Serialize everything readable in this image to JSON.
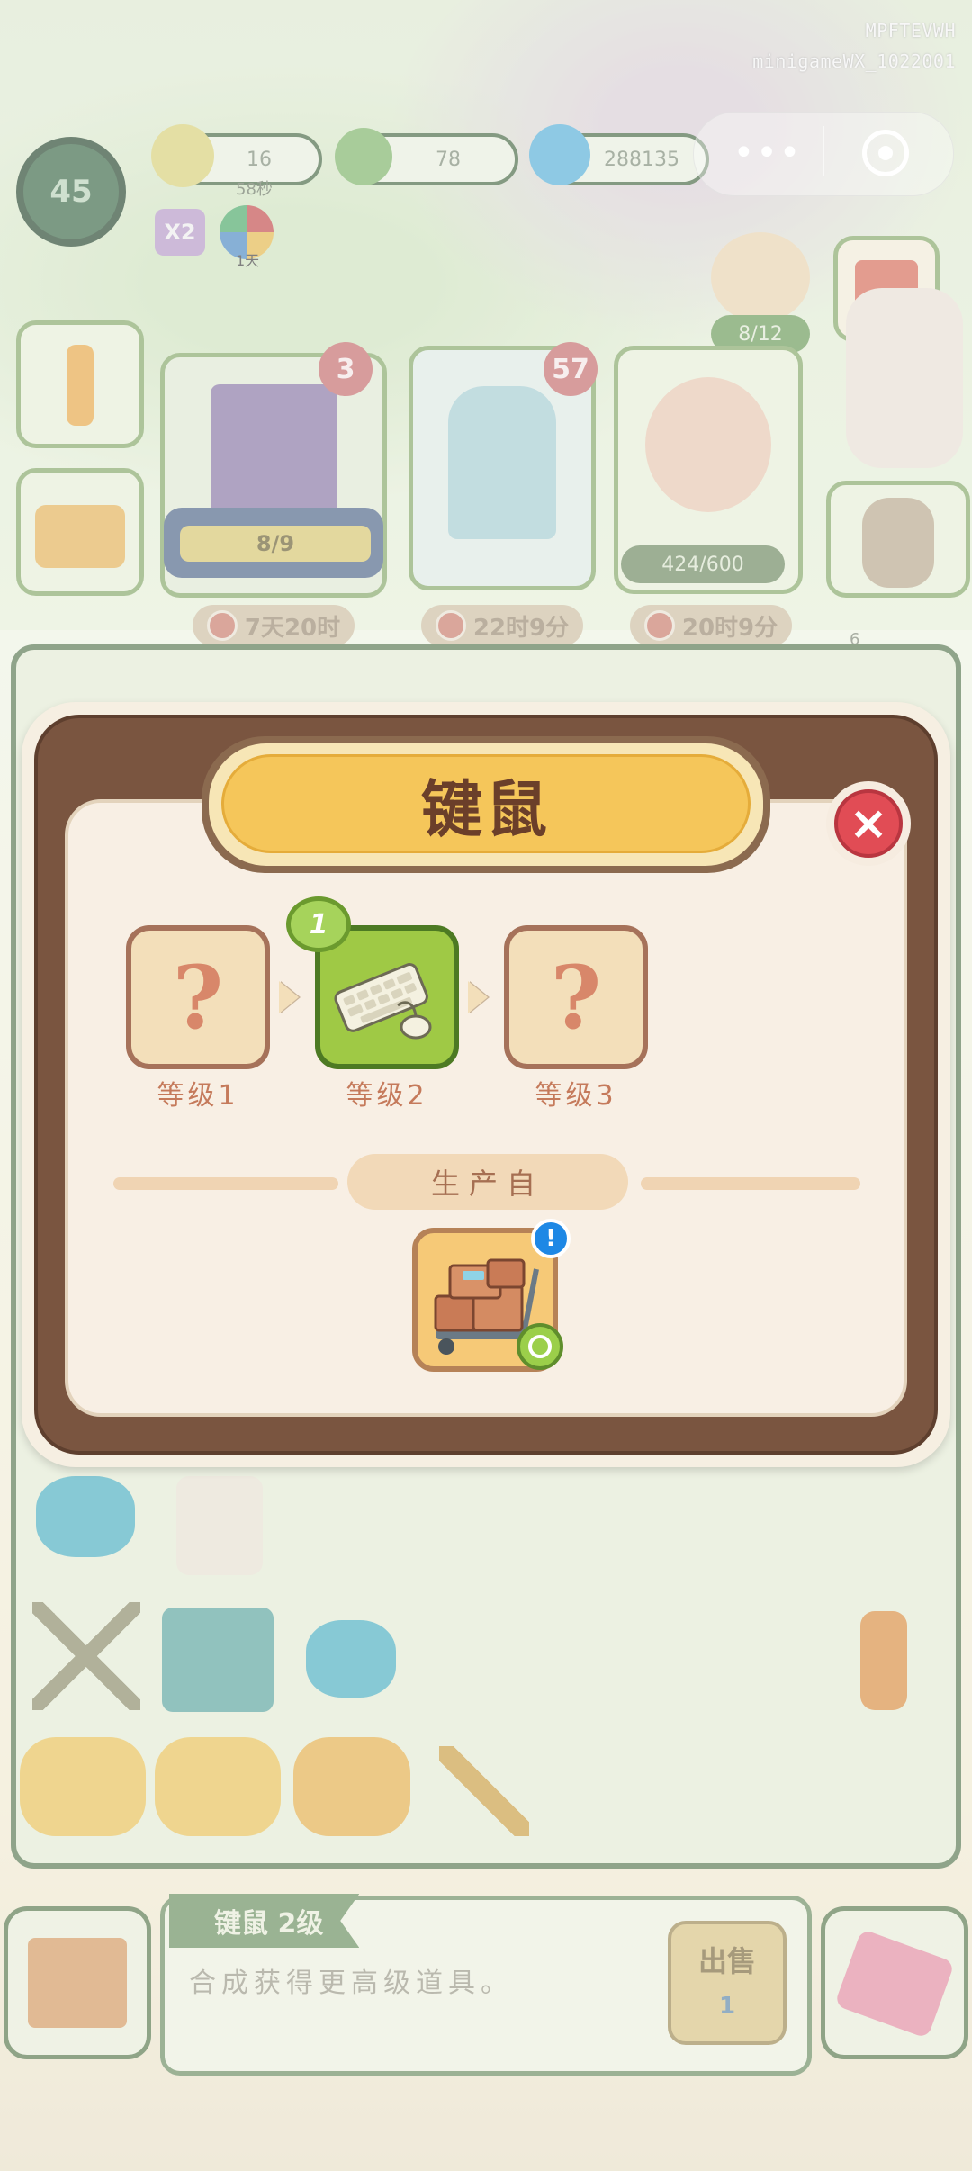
{
  "watermark": {
    "line1": "MPFTEVWH",
    "line2": "minigameWX_1022001"
  },
  "hud": {
    "level": "45",
    "energy": "16",
    "energy_timer": "58秒",
    "coins": "78",
    "gems": "288135",
    "multiplier": "X2",
    "pie_badge": "1天"
  },
  "tasks": {
    "task1_badge": "3",
    "task1_progress": "8/9",
    "task2_badge": "57",
    "task3_progress": "424/600",
    "character_progress": "8/12",
    "timer1": "7天20时",
    "timer2": "22时9分",
    "timer3": "20时9分",
    "side_count": "6"
  },
  "modal": {
    "title": "键鼠",
    "levels": [
      {
        "label": "等级1",
        "state": "unknown",
        "glyph": "?"
      },
      {
        "label": "等级2",
        "state": "current",
        "icon": "keyboard-mouse-icon"
      },
      {
        "label": "等级3",
        "state": "unknown",
        "glyph": "?"
      }
    ],
    "owned_count": "1",
    "produced_from_label": "生产自",
    "producer_icon": "cart-with-boxes-icon",
    "info_glyph": "!",
    "close_glyph": "×"
  },
  "bottom": {
    "item_name": "键鼠 2级",
    "description": "合成获得更高级道具。",
    "sell_label": "出售",
    "sell_price": "1"
  },
  "colors": {
    "accent_gold": "#f5c65a",
    "frame_brown": "#7a5540",
    "level_green": "#9fc945",
    "close_red": "#e14c55"
  }
}
